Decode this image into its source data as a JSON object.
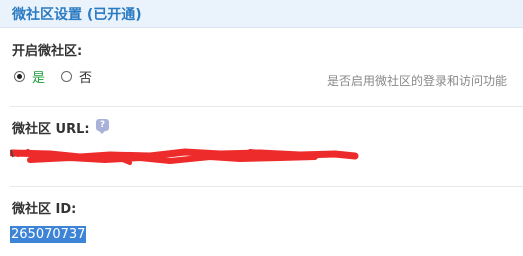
{
  "section": {
    "title": "微社区设置 (已开通)"
  },
  "enable": {
    "label": "开启微社区:",
    "options": [
      {
        "label": "是",
        "checked": true
      },
      {
        "label": "否",
        "checked": false
      }
    ],
    "hint": "是否启用微社区的登录和访问功能"
  },
  "url": {
    "label": "微社区 URL:",
    "help_icon": "question-bubble-icon",
    "value_redacted": true
  },
  "community_id": {
    "label": "微社区 ID:",
    "value": "265070737"
  },
  "colors": {
    "header_text": "#2b7bc3",
    "header_bg": "#eaf3fb",
    "yes_text": "#1b9e3a",
    "redaction": "#ee2b2b",
    "selection": "#3d84d6"
  }
}
